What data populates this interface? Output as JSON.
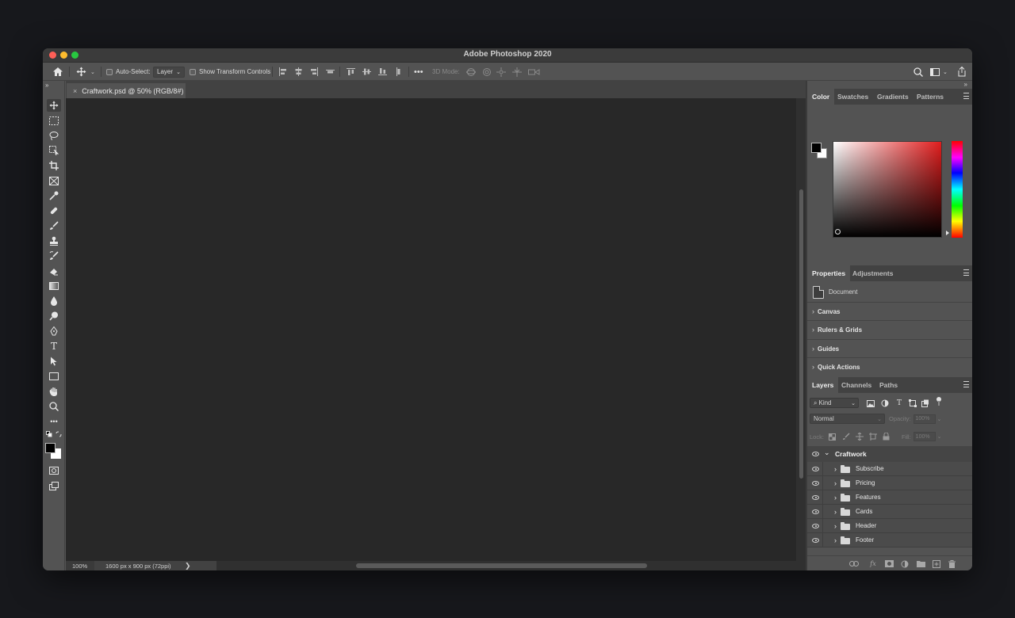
{
  "window": {
    "title": "Adobe Photoshop 2020"
  },
  "options_bar": {
    "auto_select_label": "Auto-Select:",
    "auto_select_target": "Layer",
    "show_transform_label": "Show Transform Controls",
    "more_label": "•••",
    "three_d_mode_label": "3D Mode:"
  },
  "document_tab": {
    "title": "Craftwork.psd @ 50% (RGB/8#)",
    "close_glyph": "×"
  },
  "status_bar": {
    "zoom": "100%",
    "dimensions": "1600 px x 900 px (72ppi)",
    "more_glyph": "❯"
  },
  "color_panel": {
    "tabs": [
      "Color",
      "Swatches",
      "Gradients",
      "Patterns"
    ],
    "active_tab": "Color",
    "foreground": "#000000",
    "background": "#ffffff",
    "hue_color": "#e01d1d"
  },
  "properties_panel": {
    "tabs": [
      "Properties",
      "Adjustments"
    ],
    "active_tab": "Properties",
    "document_label": "Document",
    "sections": [
      "Canvas",
      "Rulers & Grids",
      "Guides",
      "Quick Actions"
    ]
  },
  "layers_panel": {
    "tabs": [
      "Layers",
      "Channels",
      "Paths"
    ],
    "active_tab": "Layers",
    "filter_label": "Kind",
    "blend_mode": "Normal",
    "opacity_label": "Opacity:",
    "opacity_value": "100%",
    "lock_label": "Lock:",
    "fill_label": "Fill:",
    "fill_value": "100%",
    "group_name": "Craftwork",
    "layers": [
      {
        "name": "Subscribe"
      },
      {
        "name": "Pricing"
      },
      {
        "name": "Features"
      },
      {
        "name": "Cards"
      },
      {
        "name": "Header"
      },
      {
        "name": "Footer"
      }
    ],
    "footer_icons": [
      "link-icon",
      "fx-icon",
      "mask-icon",
      "adjustment-icon",
      "new-group-icon",
      "new-layer-icon",
      "trash-icon"
    ]
  },
  "toolbox": {
    "tools": [
      "move-tool",
      "marquee-tool",
      "lasso-tool",
      "object-select-tool",
      "crop-tool",
      "frame-tool",
      "eyedropper-tool",
      "healing-tool",
      "brush-tool",
      "stamp-tool",
      "history-brush-tool",
      "eraser-tool",
      "gradient-tool",
      "blur-tool",
      "dodge-tool",
      "pen-tool",
      "type-tool",
      "path-select-tool",
      "rectangle-tool",
      "hand-tool",
      "zoom-tool",
      "more-tools"
    ],
    "more_glyph": "•••",
    "type_glyph": "T"
  },
  "colors": {
    "canvas": "#282828",
    "chrome": "#535353",
    "panel_dark": "#424242"
  }
}
